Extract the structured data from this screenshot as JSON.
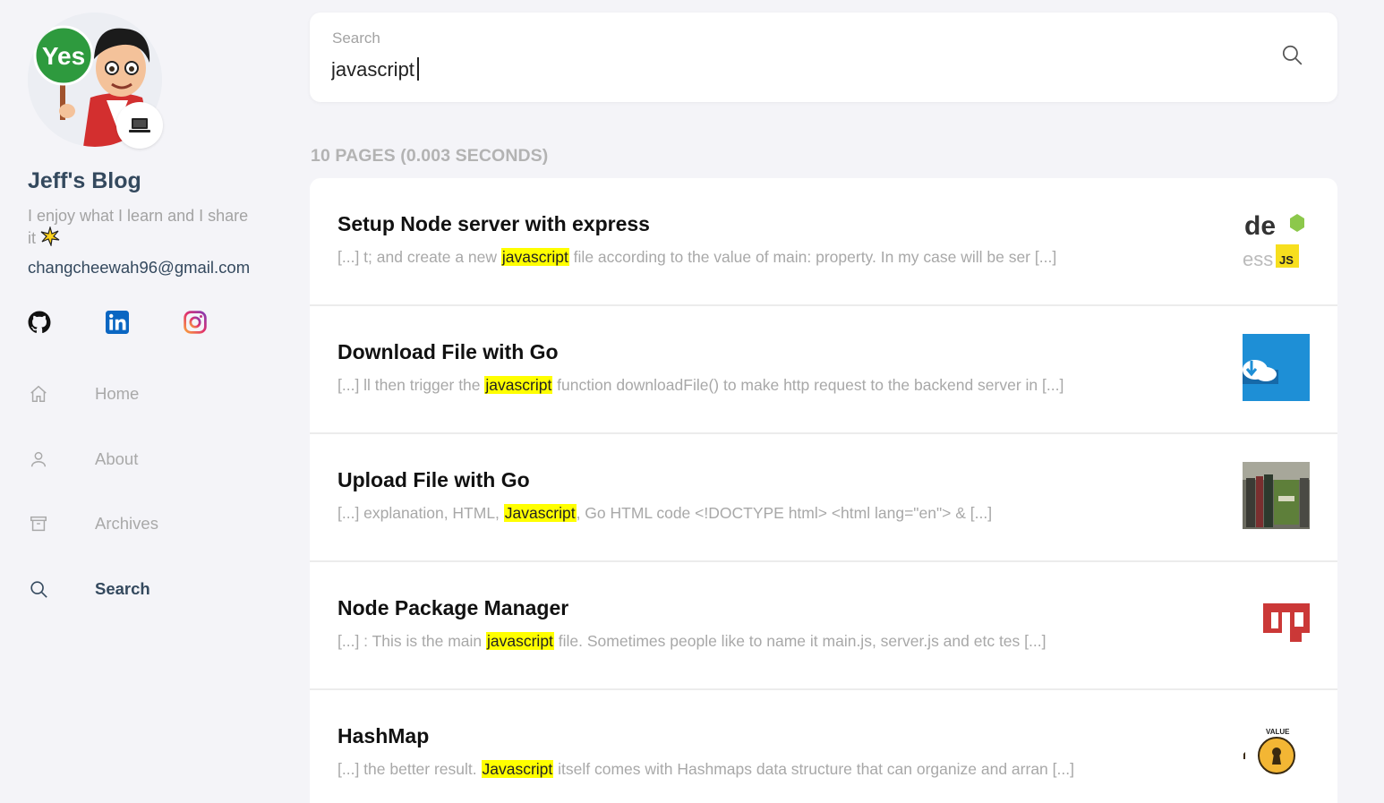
{
  "sidebar": {
    "site_title": "Jeff's Blog",
    "tagline": "I enjoy what I learn and I share it",
    "email": "changcheewah96@gmail.com",
    "social_links": [
      {
        "name": "github-icon"
      },
      {
        "name": "linkedin-icon"
      },
      {
        "name": "instagram-icon"
      }
    ],
    "nav": [
      {
        "label": "Home",
        "icon": "home-icon"
      },
      {
        "label": "About",
        "icon": "user-icon"
      },
      {
        "label": "Archives",
        "icon": "archive-icon"
      },
      {
        "label": "Search",
        "icon": "search-icon",
        "active": true
      }
    ]
  },
  "search": {
    "label": "Search",
    "value": "javascript"
  },
  "results_count": "10 PAGES (0.003 SECONDS)",
  "results": [
    {
      "title": "Setup Node server with express",
      "snippet_before": "[...] t; and create a new ",
      "snippet_highlight": "javascript",
      "snippet_after": " file according to the value of main: property. In my case will be ser [...]",
      "thumb": "node-express-thumbnail"
    },
    {
      "title": "Download File with Go",
      "snippet_before": "[...] ll then trigger the ",
      "snippet_highlight": "javascript",
      "snippet_after": " function downloadFile() to make http request to the backend server in [...]",
      "thumb": "cloud-download-thumbnail"
    },
    {
      "title": "Upload File with Go",
      "snippet_before": "[...] explanation, HTML, ",
      "snippet_highlight": "Javascript",
      "snippet_after": ", Go HTML code <!DOCTYPE html> <html lang=\"en\"> & [...]",
      "thumb": "files-folder-thumbnail"
    },
    {
      "title": "Node Package Manager",
      "snippet_before": "[...] : This is the main ",
      "snippet_highlight": "javascript",
      "snippet_after": " file. Sometimes people like to name it main.js, server.js and etc tes [...]",
      "thumb": "npm-logo-thumbnail"
    },
    {
      "title": "HashMap",
      "snippet_before": "[...] the better result. ",
      "snippet_highlight": "Javascript",
      "snippet_after": " itself comes with Hashmaps data structure that can organize and arran [...]",
      "thumb": "key-value-thumbnail"
    }
  ],
  "thumb_labels": {
    "node_top": "de",
    "node_bottom": "ess",
    "js": "JS",
    "value": "VALUE"
  },
  "avatar_sign": "Yes",
  "colors": {
    "highlight": "#ffff00",
    "title": "#34495e",
    "muted": "#a8a8a8",
    "background": "#f4f4f8"
  }
}
